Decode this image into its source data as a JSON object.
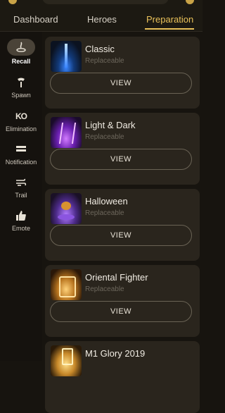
{
  "tabs": [
    "Dashboard",
    "Heroes",
    "Preparation"
  ],
  "active_tab": "Preparation",
  "sidebar": {
    "items": [
      {
        "label": "Recall",
        "icon": "recall-icon"
      },
      {
        "label": "Spawn",
        "icon": "spawn-icon"
      },
      {
        "label": "Elimination",
        "icon": "ko-icon"
      },
      {
        "label": "Notification",
        "icon": "notification-icon"
      },
      {
        "label": "Trail",
        "icon": "trail-icon"
      },
      {
        "label": "Emote",
        "icon": "thumbs-up-icon"
      }
    ],
    "ko_text": "KO"
  },
  "cards": [
    {
      "title": "Classic",
      "sub": "Replaceable",
      "action": "VIEW",
      "accent": "#3a86ff"
    },
    {
      "title": "Light & Dark",
      "sub": "Replaceable",
      "action": "VIEW",
      "accent": "#a14dff"
    },
    {
      "title": "Halloween",
      "sub": "Replaceable",
      "action": "VIEW",
      "accent": "#c07cff"
    },
    {
      "title": "Oriental Fighter",
      "sub": "Replaceable",
      "action": "VIEW",
      "accent": "#e6a43a"
    },
    {
      "title": "M1 Glory 2019",
      "sub": "",
      "action": "",
      "accent": "#e6b54a"
    }
  ],
  "colors": {
    "accent": "#e9c15a",
    "card": "#2a251d",
    "background": "#17140f"
  }
}
